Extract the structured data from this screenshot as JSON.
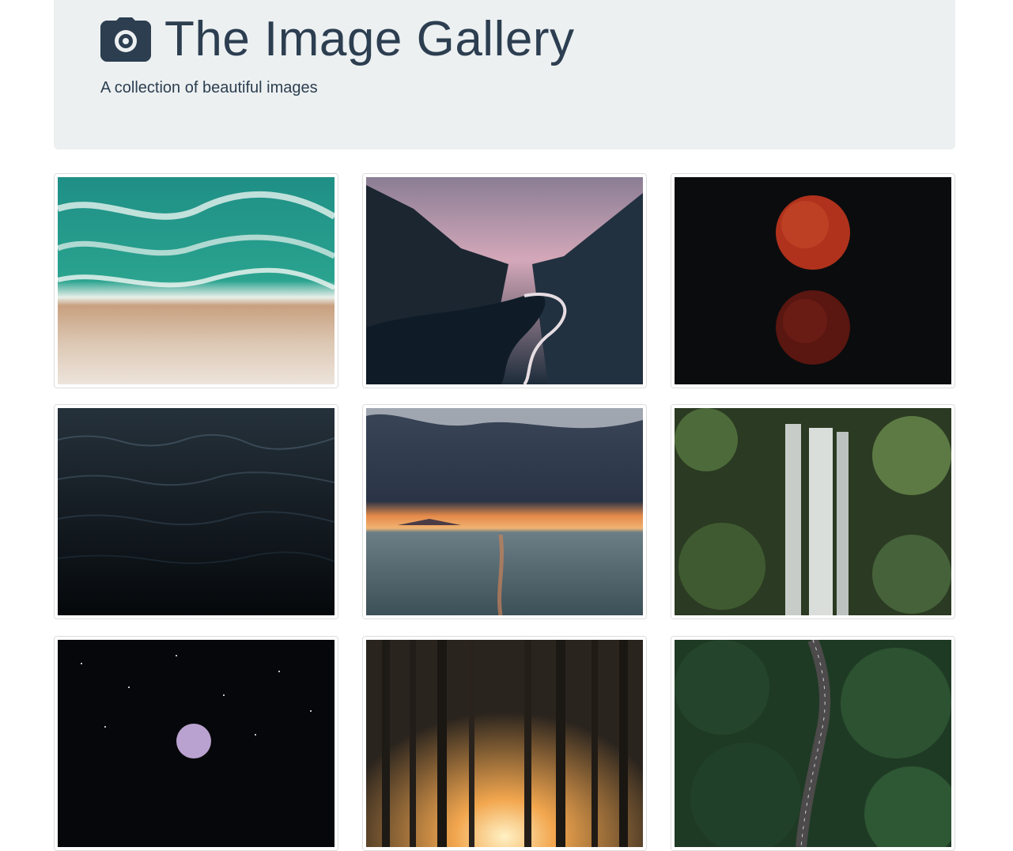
{
  "header": {
    "title": "The Image Gallery",
    "subtitle": "A collection of beautiful images",
    "icon": "camera-icon",
    "text_color": "#2c3e50",
    "background": "#ecf0f1"
  },
  "gallery": {
    "images": [
      {
        "name": "image-ocean-beach-aerial",
        "icon": "photo"
      },
      {
        "name": "image-mountain-river-dusk",
        "icon": "photo"
      },
      {
        "name": "image-blood-moon-eclipse",
        "icon": "photo"
      },
      {
        "name": "image-dark-ocean-waves",
        "icon": "photo"
      },
      {
        "name": "image-sunset-lake-clouds",
        "icon": "photo"
      },
      {
        "name": "image-forest-waterfall",
        "icon": "photo"
      },
      {
        "name": "image-moon-starry-sky",
        "icon": "photo"
      },
      {
        "name": "image-sunlit-forest",
        "icon": "photo"
      },
      {
        "name": "image-forest-road-aerial",
        "icon": "photo"
      }
    ]
  }
}
